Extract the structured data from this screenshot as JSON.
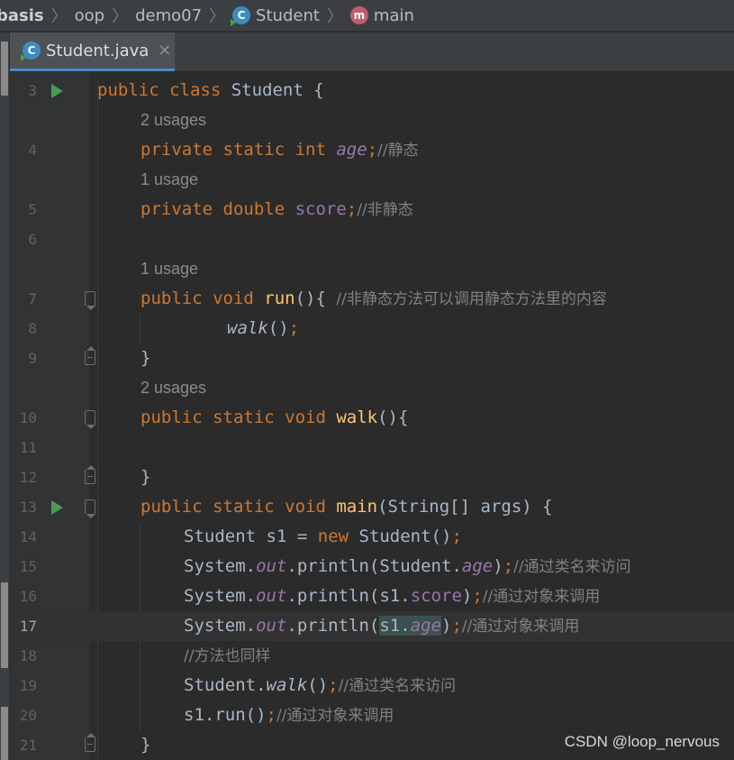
{
  "breadcrumb": {
    "items": [
      {
        "label": "basis"
      },
      {
        "label": "oop"
      },
      {
        "label": "demo07"
      },
      {
        "label": "Student",
        "icon": "class-icon",
        "icon_letter": "C"
      },
      {
        "label": "main",
        "icon": "method-icon",
        "icon_letter": "m"
      }
    ]
  },
  "tabs": {
    "active": {
      "label": "Student.java",
      "icon_letter": "C",
      "close": "✕"
    }
  },
  "editor": {
    "line_numbers": [
      "3",
      "4",
      "5",
      "6",
      "7",
      "8",
      "9",
      "10",
      "11",
      "12",
      "13",
      "14",
      "15",
      "16",
      "17",
      "18",
      "19",
      "20",
      "21"
    ],
    "usages": {
      "age": "2 usages",
      "score": "1 usage",
      "run": "1 usage",
      "walk": "2 usages"
    },
    "current_line": "17"
  },
  "colors": {
    "keyword": "#cc7832",
    "method": "#ffc66d",
    "field": "#9876aa",
    "comment": "#808080",
    "text": "#a9b7c6",
    "background": "#2b2b2b",
    "accent": "#4a88c7"
  },
  "watermark": "CSDN @loop_nervous"
}
